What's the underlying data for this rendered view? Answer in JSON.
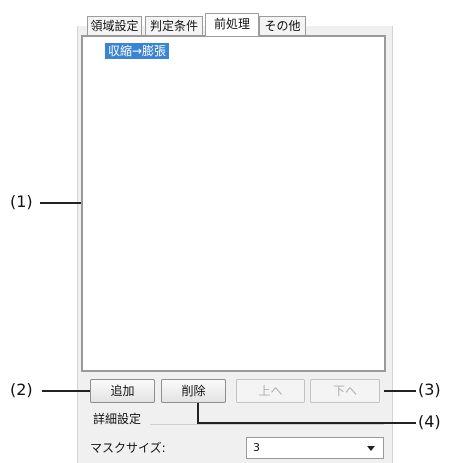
{
  "tabs": [
    {
      "label": "領域設定"
    },
    {
      "label": "判定条件"
    },
    {
      "label": "前処理",
      "active": true
    },
    {
      "label": "その他"
    }
  ],
  "list": {
    "items": [
      "収縮→膨張"
    ]
  },
  "buttons": {
    "add": "追加",
    "delete": "削除",
    "up": "上へ",
    "down": "下へ"
  },
  "details": {
    "group_label": "詳細設定",
    "mask_size_label": "マスクサイズ:",
    "mask_size_value": "3"
  },
  "callouts": {
    "c1": "(1)",
    "c2": "(2)",
    "c3": "(3)",
    "c4": "(4)"
  }
}
